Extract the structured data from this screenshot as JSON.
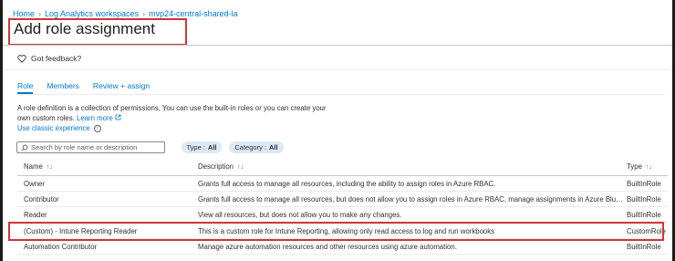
{
  "breadcrumb": [
    "Home",
    "Log Analytics workspaces",
    "mvp24-central-shared-la"
  ],
  "page": {
    "title": "Add role assignment",
    "more": "···"
  },
  "feedback": {
    "label": "Got feedback?"
  },
  "tabs": [
    {
      "label": "Role",
      "selected": true
    },
    {
      "label": "Members",
      "selected": false
    },
    {
      "label": "Review + assign",
      "selected": false
    }
  ],
  "description": {
    "text": "A role definition is a collection of permissions. You can use the built-in roles or you can create your own custom roles.",
    "learn_more": "Learn more",
    "classic": "Use classic experience"
  },
  "search": {
    "placeholder": "Search by role name or description"
  },
  "filters": [
    {
      "label": "Type :",
      "value": "All"
    },
    {
      "label": "Category :",
      "value": "All"
    }
  ],
  "table": {
    "columns": {
      "name": "Name",
      "description": "Description",
      "type": "Type",
      "sort": "↑↓"
    },
    "rows": [
      {
        "name": "Owner",
        "description": "Grants full access to manage all resources, including the ability to assign roles in Azure RBAC.",
        "type": "BuiltInRole"
      },
      {
        "name": "Contributor",
        "description": "Grants full access to manage all resources, but does not allow you to assign roles in Azure RBAC, manage assignments in Azure Blueprints, or share image galleries.",
        "type": "BuiltInRole"
      },
      {
        "name": "Reader",
        "description": "View all resources, but does not allow you to make any changes.",
        "type": "BuiltInRole"
      },
      {
        "name": "(Custom) - Intune Reporting Reader",
        "description": "This is a custom role for Intune Reporting, allowing only read access to log and run workbooks",
        "type": "CustomRole"
      },
      {
        "name": "Automation Contributor",
        "description": "Manage azure automation resources and other resources using azure automation.",
        "type": "BuiltInRole"
      }
    ]
  },
  "colors": {
    "accent": "#0078d4",
    "highlight": "#d13438"
  }
}
